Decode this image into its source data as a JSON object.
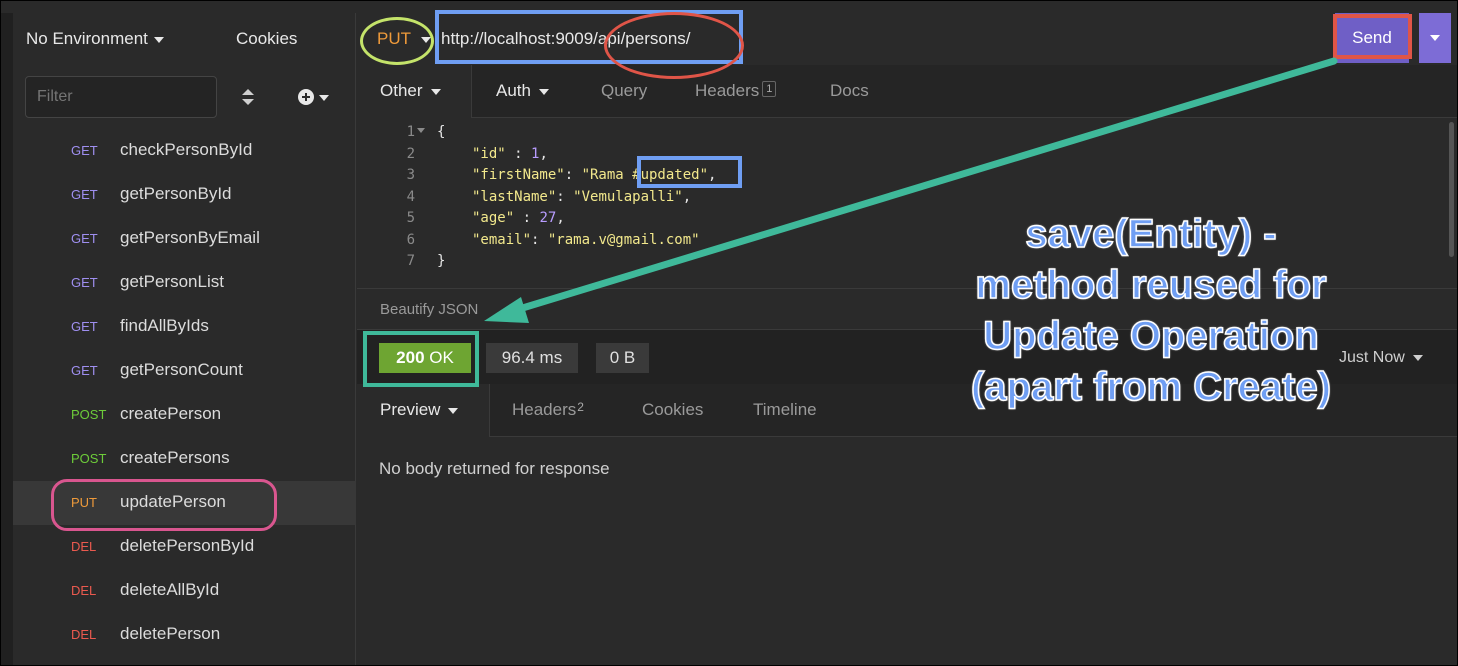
{
  "sidebar": {
    "environment": "No Environment",
    "cookies": "Cookies",
    "filter_placeholder": "Filter",
    "requests": [
      {
        "method": "GET",
        "name": "checkPersonById"
      },
      {
        "method": "GET",
        "name": "getPersonById"
      },
      {
        "method": "GET",
        "name": "getPersonByEmail"
      },
      {
        "method": "GET",
        "name": "getPersonList"
      },
      {
        "method": "GET",
        "name": "findAllByIds"
      },
      {
        "method": "GET",
        "name": "getPersonCount"
      },
      {
        "method": "POST",
        "name": "createPerson"
      },
      {
        "method": "POST",
        "name": "createPersons"
      },
      {
        "method": "PUT",
        "name": "updatePerson",
        "active": true
      },
      {
        "method": "DEL",
        "name": "deletePersonById"
      },
      {
        "method": "DEL",
        "name": "deleteAllById"
      },
      {
        "method": "DEL",
        "name": "deletePerson"
      }
    ]
  },
  "request": {
    "method": "PUT",
    "url": "http://localhost:9009/api/persons/",
    "send_label": "Send",
    "tabs": {
      "other": "Other",
      "auth": "Auth",
      "query": "Query",
      "headers": "Headers",
      "headers_count": "1",
      "docs": "Docs"
    },
    "body_lines": [
      "1",
      "2",
      "3",
      "4",
      "5",
      "6",
      "7"
    ],
    "body": {
      "l1": "{",
      "id_key": "\"id\"",
      "id_val": "1",
      "first_key": "\"firstName\"",
      "first_val": "\"Rama #updated\"",
      "last_key": "\"lastName\"",
      "last_val": "\"Vemulapalli\"",
      "age_key": "\"age\"",
      "age_val": "27",
      "email_key": "\"email\"",
      "email_val": "\"rama.v@gmail.com\"",
      "l7": "}"
    },
    "beautify": "Beautify JSON"
  },
  "response": {
    "status_code": "200",
    "status_text": "OK",
    "time": "96.4 ms",
    "size": "0 B",
    "timestamp": "Just Now",
    "tabs": {
      "preview": "Preview",
      "headers": "Headers",
      "headers_count": "2",
      "cookies": "Cookies",
      "timeline": "Timeline"
    },
    "body_message": "No body returned for response"
  },
  "annotation": {
    "line1": "save(Entity) -",
    "line2": "method reused for",
    "line3": "Update Operation",
    "line4": "(apart from Create)"
  },
  "colors": {
    "get": "#9f8ff0",
    "post": "#6dcc3a",
    "put": "#ee9a3a",
    "del": "#ea5a4f",
    "send": "#6f5fc6",
    "status_ok": "#6ea532",
    "annotation_text": "#6f9ef3",
    "arrow": "#3fb99a"
  }
}
